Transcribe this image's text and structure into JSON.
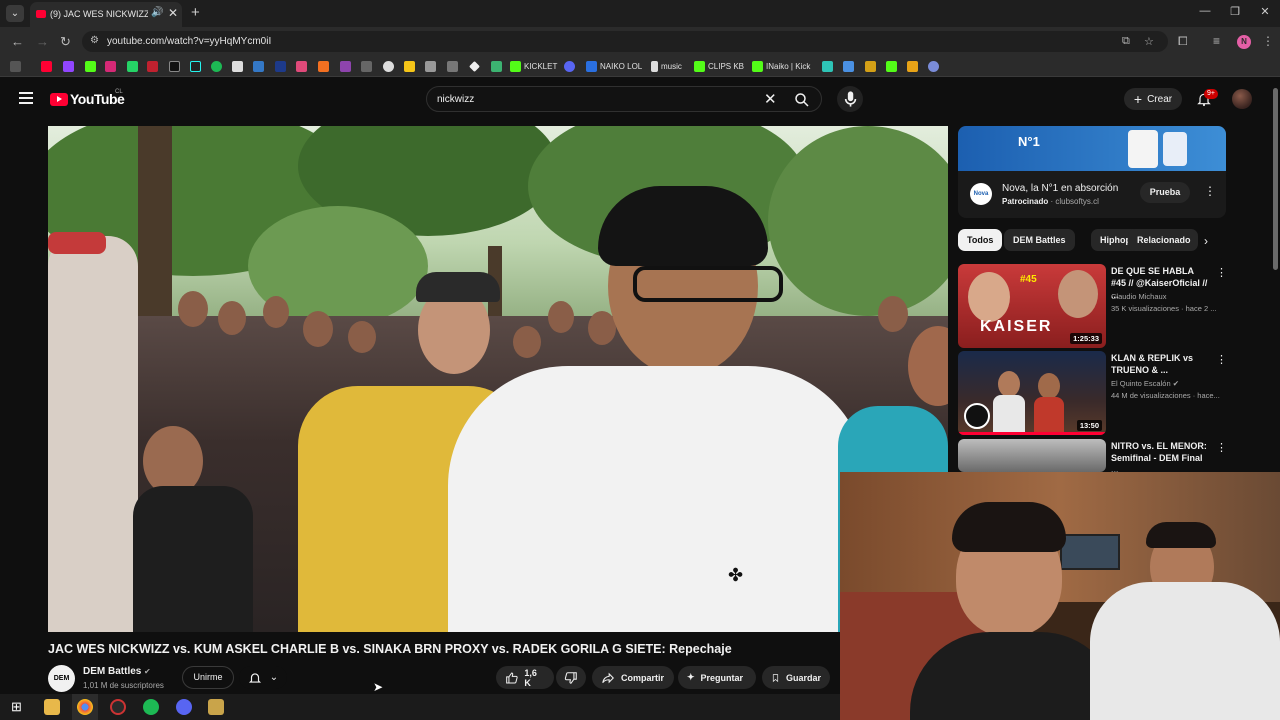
{
  "browser": {
    "tab_title": "(9) JAC WES NICKWIZZ vs. K",
    "tab_audio_icon": "speaker-icon",
    "url": "youtube.com/watch?v=yyHqMYcm0iI",
    "bookmarks": [
      {
        "label": "KICKLET",
        "color": "#53fc18"
      },
      {
        "label": "NAIKO LOL",
        "color": "#2a6fe0"
      },
      {
        "label": "music",
        "color": "#dddddd"
      },
      {
        "label": "CLIPS KB",
        "color": "#53fc18"
      },
      {
        "label": "INaiko | Kick",
        "color": "#53fc18"
      }
    ]
  },
  "header": {
    "logo": "YouTube",
    "country": "CL",
    "search_query": "nickwizz",
    "create_label": "Crear",
    "notif_count": "9+"
  },
  "video": {
    "title": "JAC WES NICKWIZZ vs. KUM ASKEL CHARLIE B vs. SINAKA BRN PROXY vs. RADEK GORILA G SIETE: Repechaje",
    "channel": "DEM Battles",
    "channel_avatar_text": "DEM",
    "subscribers": "1,01 M de suscriptores",
    "join_label": "Unirme",
    "likes": "1,6 K",
    "share_label": "Compartir",
    "ask_label": "Preguntar",
    "save_label": "Guardar"
  },
  "ad": {
    "banner_text": "N°1",
    "brand_icon": "Nova",
    "title": "Nova, la N°1 en absorción",
    "sponsored": "Patrocinado",
    "domain": "clubsoftys.cl",
    "cta": "Prueba"
  },
  "chips": [
    "Todos",
    "DEM Battles",
    "Hiphop",
    "Relacionado"
  ],
  "recommendations": [
    {
      "title": "DE QUE SE HABLA #45 // @KaiserOficial // ...",
      "channel": "Claudio Michaux",
      "meta": "35 K visualizaciones · hace 2 ...",
      "duration": "1:25:33",
      "thumb_text": "KAISER",
      "thumb_tag": "#45"
    },
    {
      "title": "KLAN & REPLIK vs TRUENO & ...",
      "channel": "El Quinto Escalón",
      "meta": "44 M de visualizaciones · hace...",
      "duration": "13:50",
      "thumb_text": "",
      "thumb_tag": ""
    },
    {
      "title": "NITRO vs. EL MENOR: Semifinal - DEM Final ...",
      "channel": "",
      "meta": "",
      "duration": "",
      "thumb_text": "",
      "thumb_tag": ""
    }
  ]
}
